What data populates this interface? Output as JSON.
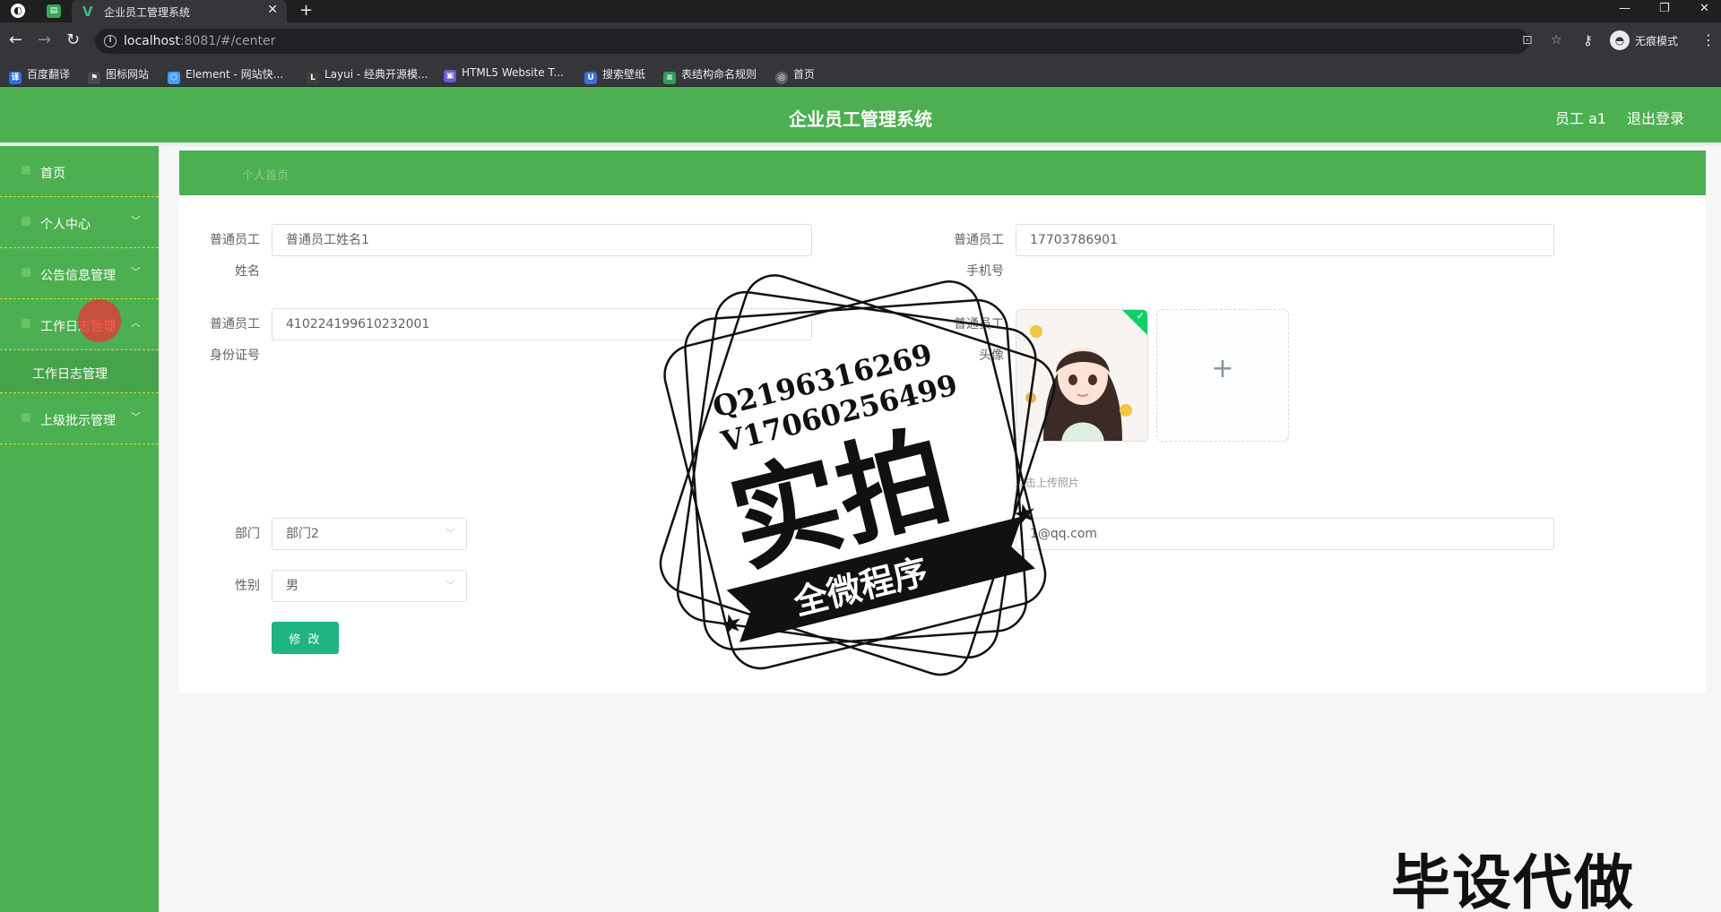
{
  "browser": {
    "tab_title": "企业员工管理系统",
    "url_host": "localhost",
    "url_path": ":8081/#/center",
    "incognito_label": "无痕模式",
    "bookmarks": [
      {
        "label": "百度翻译",
        "icon_color": "#2b6ee6"
      },
      {
        "label": "图标网站",
        "icon_color": "#4a4a4a"
      },
      {
        "label": "Element - 网站快...",
        "icon_color": "#409eff"
      },
      {
        "label": "Layui - 经典开源模...",
        "icon_color": "#3f3f3f"
      },
      {
        "label": "HTML5 Website T...",
        "icon_color": "#6b5bd3"
      },
      {
        "label": "搜索壁纸",
        "icon_color": "#3b6fd6"
      },
      {
        "label": "表结构命名规则",
        "icon_color": "#2e9e5b"
      },
      {
        "label": "首页",
        "icon_color": "#5f6368"
      }
    ]
  },
  "app": {
    "title": "企业员工管理系统",
    "user_label": "员工 a1",
    "logout_label": "退出登录",
    "accent_color": "#4caf50",
    "breadcrumb": "个人首页"
  },
  "sidebar": {
    "items": [
      {
        "label": "首页"
      },
      {
        "label": "个人中心",
        "arrow": "﹀"
      },
      {
        "label": "公告信息管理",
        "arrow": "﹀"
      },
      {
        "label": "工作日志管理",
        "arrow": "︿"
      },
      {
        "label": "上级批示管理",
        "arrow": "﹀"
      }
    ],
    "submenu": [
      {
        "label": "工作日志管理"
      }
    ]
  },
  "form": {
    "name_label_1": "普通员工",
    "name_label_2": "姓名",
    "name_value": "普通员工姓名1",
    "phone_label_1": "普通员工",
    "phone_label_2": "手机号",
    "phone_value": "17703786901",
    "idcard_label_1": "普通员工",
    "idcard_label_2": "身份证号",
    "idcard_value": "410224199610232001",
    "avatar_label_1": "普通员工",
    "avatar_label_2": "头像",
    "upload_tip": "点击上传照片",
    "email_value": "1@qq.com",
    "dept_label": "部门",
    "dept_value": "部门2",
    "gender_label": "性别",
    "gender_value": "男",
    "submit_label": "修 改"
  },
  "watermark": {
    "qq": "Q2196316269",
    "vx": "V17060256499",
    "big": "实拍",
    "ribbon": "全微程序",
    "corner": "毕设代做"
  }
}
